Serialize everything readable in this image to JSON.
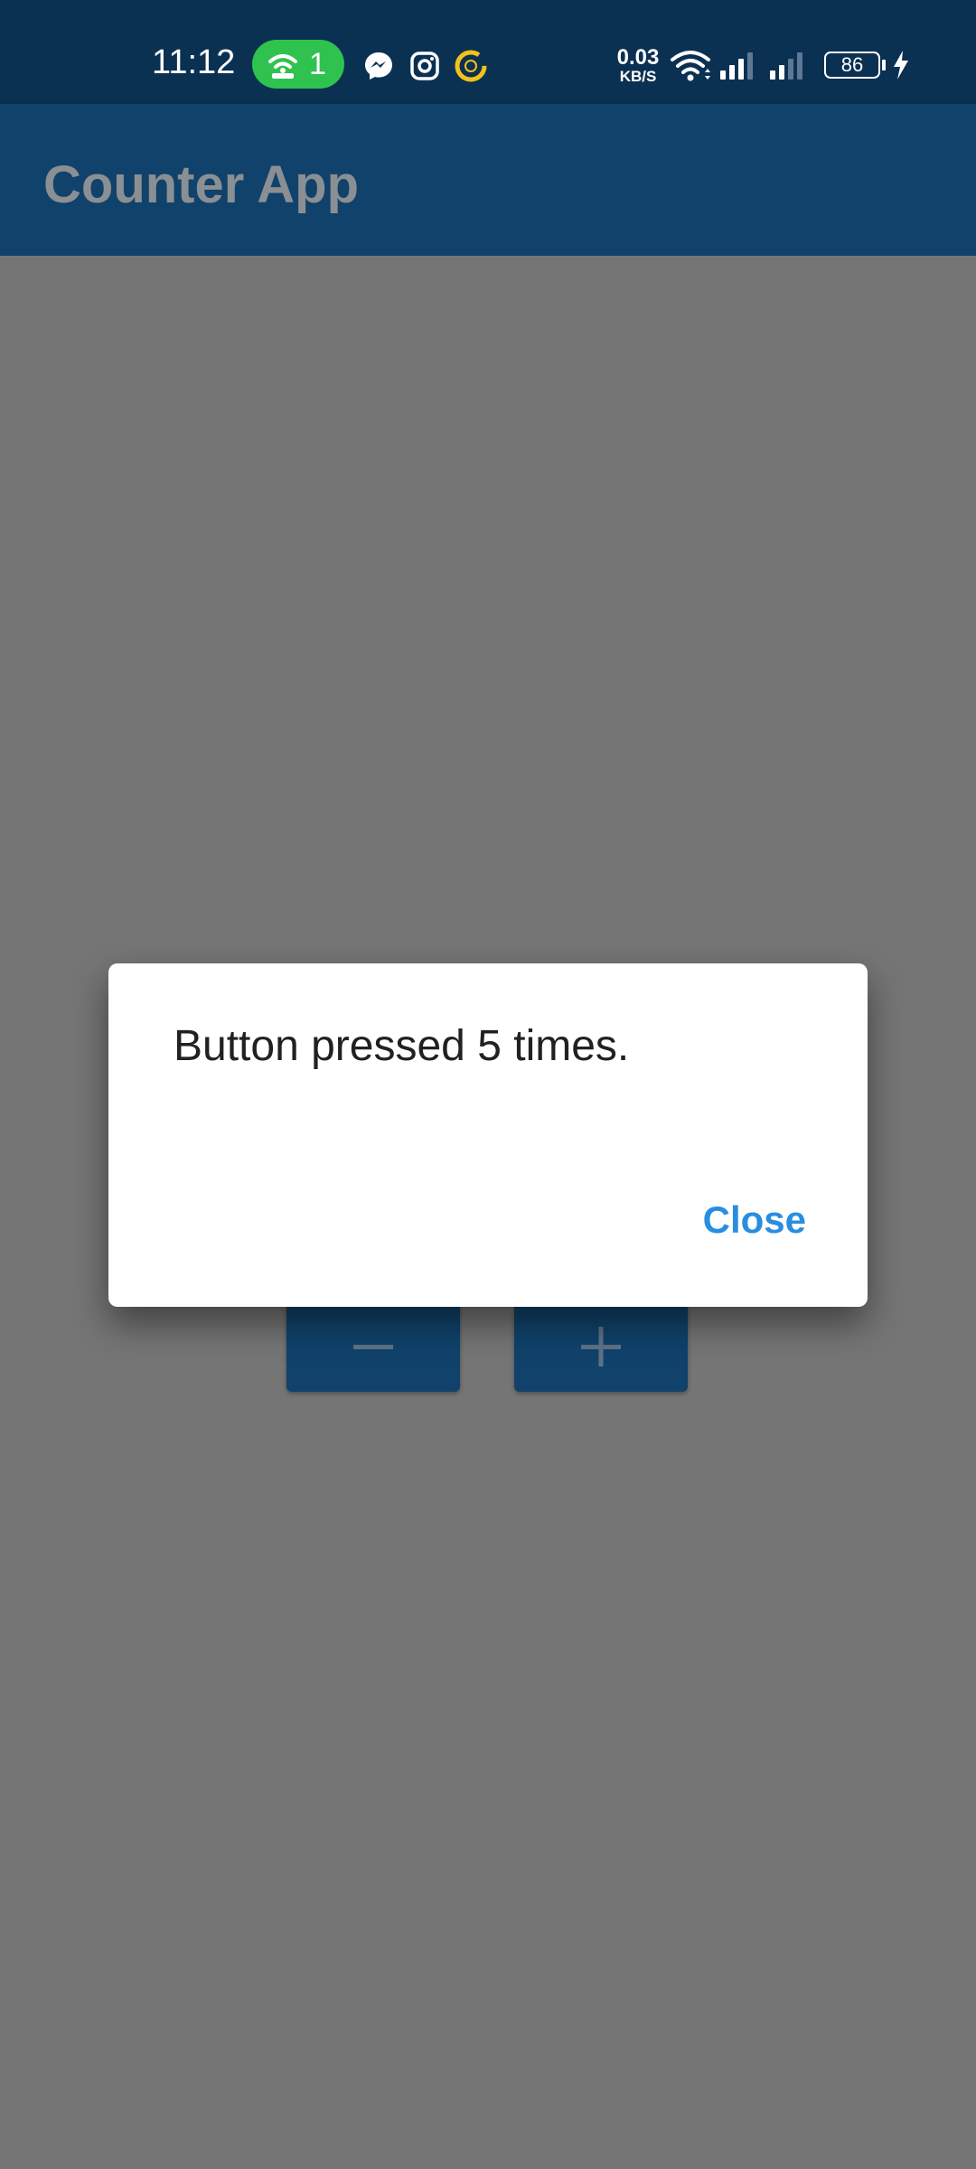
{
  "status_bar": {
    "time": "11:12",
    "hotspot_count": "1",
    "notification_icons": [
      "messenger-icon",
      "instagram-icon",
      "sync-icon"
    ],
    "network_speed_value": "0.03",
    "network_speed_unit": "KB/S",
    "battery_level": "86",
    "icons": [
      "hotspot-icon",
      "wifi-icon",
      "signal-icon",
      "signal-icon",
      "charging-icon"
    ]
  },
  "app_bar": {
    "title": "Counter App"
  },
  "controls": {
    "decrement_icon": "minus-icon",
    "increment_icon": "plus-icon"
  },
  "dialog": {
    "message": "Button pressed 5 times.",
    "close_label": "Close"
  },
  "colors": {
    "status_bar": "#0b3152",
    "app_bar": "#10426b",
    "scrim_background": "#757575",
    "dialog_action": "#2a8ee0",
    "hotspot_pill": "#2fc24f"
  }
}
